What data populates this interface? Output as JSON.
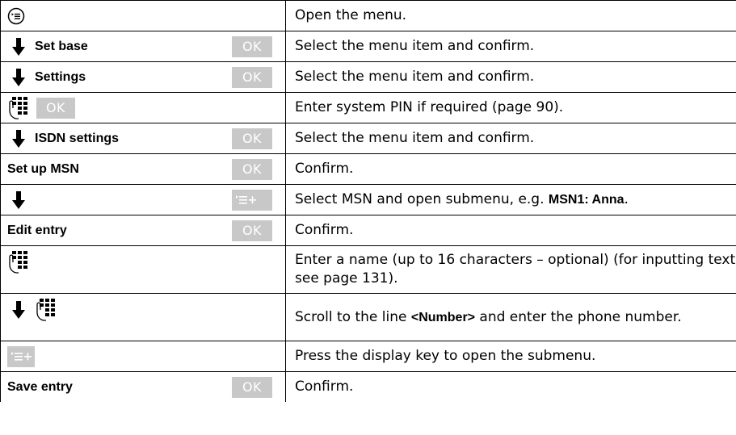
{
  "rows": [
    {
      "left_text": "",
      "desc_pre": "Open the menu.",
      "desc_bold": "",
      "desc_post": ""
    },
    {
      "left_text": "Set base",
      "ok": "OK",
      "desc_pre": "Select the menu item and confirm.",
      "desc_bold": "",
      "desc_post": ""
    },
    {
      "left_text": "Settings",
      "ok": "OK",
      "desc_pre": "Select the menu item and confirm.",
      "desc_bold": "",
      "desc_post": ""
    },
    {
      "left_text": "",
      "ok": "OK",
      "desc_pre": "Enter system PIN if required (page 90).",
      "desc_bold": "",
      "desc_post": ""
    },
    {
      "left_text": "ISDN settings",
      "ok": "OK",
      "desc_pre": "Select the menu item and confirm.",
      "desc_bold": "",
      "desc_post": ""
    },
    {
      "left_text": "Set up MSN",
      "ok": "OK",
      "desc_pre": "Confirm.",
      "desc_bold": "",
      "desc_post": ""
    },
    {
      "left_text": "",
      "desc_pre": "Select MSN and open submenu, e.g. ",
      "desc_bold": "MSN1: Anna",
      "desc_post": "."
    },
    {
      "left_text": "Edit entry",
      "ok": "OK",
      "desc_pre": "Confirm.",
      "desc_bold": "",
      "desc_post": ""
    },
    {
      "left_text": "",
      "desc_pre": "Enter a name (up to 16 characters – optional) (for inputting text see page 131).",
      "desc_bold": "",
      "desc_post": ""
    },
    {
      "left_text": "",
      "desc_pre": "Scroll to the line ",
      "desc_bold": "<Number>",
      "desc_post": " and enter the phone number."
    },
    {
      "left_text": "",
      "desc_pre": "Press the display key to open the submenu.",
      "desc_bold": "",
      "desc_post": ""
    },
    {
      "left_text": "Save entry",
      "ok": "OK",
      "desc_pre": "Confirm.",
      "desc_bold": "",
      "desc_post": ""
    }
  ],
  "icons": {
    "menu_key": "menu-key-icon",
    "down_arrow": "down-arrow-icon",
    "keypad": "keypad-icon",
    "submenu_key": "submenu-key-icon"
  },
  "colors": {
    "softkey_bg": "#c8c8c8",
    "softkey_text": "#ffffff",
    "border": "#000000"
  }
}
